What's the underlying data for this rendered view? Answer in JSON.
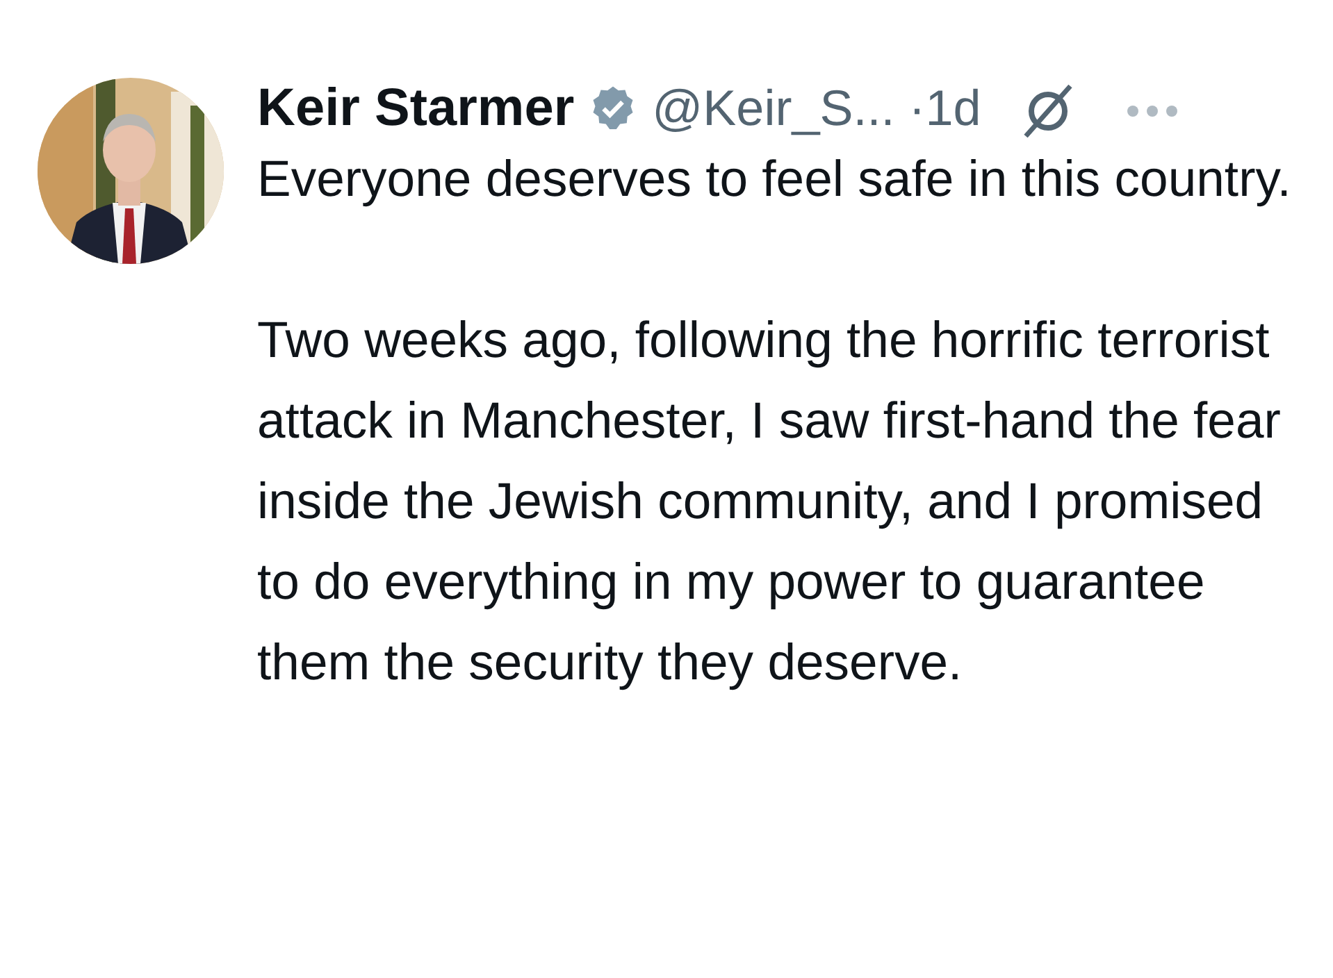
{
  "tweet": {
    "author": {
      "name": "Keir Starmer",
      "verified": true,
      "handle": "@Keir_S...",
      "time": "·1d"
    },
    "paragraphs": [
      "Everyone deserves to feel safe in this country.",
      "Two weeks ago, following the horrific terrorist attack in Manchester, I saw first-hand the fear inside the Jewish community, and I promised to do everything in my power to guarantee them the security they deserve."
    ]
  }
}
